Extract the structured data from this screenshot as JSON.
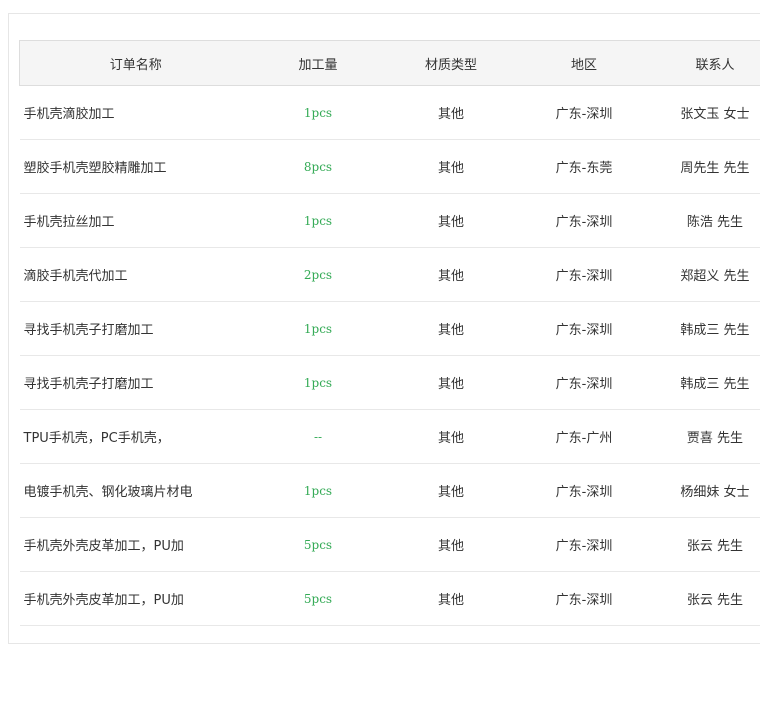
{
  "table": {
    "headers": {
      "name": "订单名称",
      "quantity": "加工量",
      "material": "材质类型",
      "region": "地区",
      "contact": "联系人"
    },
    "rows": [
      {
        "name": "手机壳滴胶加工",
        "quantity": "1pcs",
        "material": "其他",
        "region": "广东-深圳",
        "contact": "张文玉 女士"
      },
      {
        "name": "塑胶手机壳塑胶精雕加工",
        "quantity": "8pcs",
        "material": "其他",
        "region": "广东-东莞",
        "contact": "周先生 先生"
      },
      {
        "name": "手机壳拉丝加工",
        "quantity": "1pcs",
        "material": "其他",
        "region": "广东-深圳",
        "contact": "陈浩 先生"
      },
      {
        "name": "滴胶手机壳代加工",
        "quantity": "2pcs",
        "material": "其他",
        "region": "广东-深圳",
        "contact": "郑超义 先生"
      },
      {
        "name": "寻找手机壳子打磨加工",
        "quantity": "1pcs",
        "material": "其他",
        "region": "广东-深圳",
        "contact": "韩成三 先生"
      },
      {
        "name": "寻找手机壳子打磨加工",
        "quantity": "1pcs",
        "material": "其他",
        "region": "广东-深圳",
        "contact": "韩成三 先生"
      },
      {
        "name": "TPU手机壳，PC手机壳，",
        "quantity": "--",
        "material": "其他",
        "region": "广东-广州",
        "contact": "贾喜 先生"
      },
      {
        "name": "电镀手机壳、钢化玻璃片材电",
        "quantity": "1pcs",
        "material": "其他",
        "region": "广东-深圳",
        "contact": "杨细妹 女士"
      },
      {
        "name": "手机壳外壳皮革加工，PU加",
        "quantity": "5pcs",
        "material": "其他",
        "region": "广东-深圳",
        "contact": "张云 先生"
      },
      {
        "name": "手机壳外壳皮革加工，PU加",
        "quantity": "5pcs",
        "material": "其他",
        "region": "广东-深圳",
        "contact": "张云 先生"
      }
    ]
  },
  "colors": {
    "quantity_text": "#33aa55",
    "header_bg": "#f5f5f5",
    "border": "#dddddd"
  }
}
